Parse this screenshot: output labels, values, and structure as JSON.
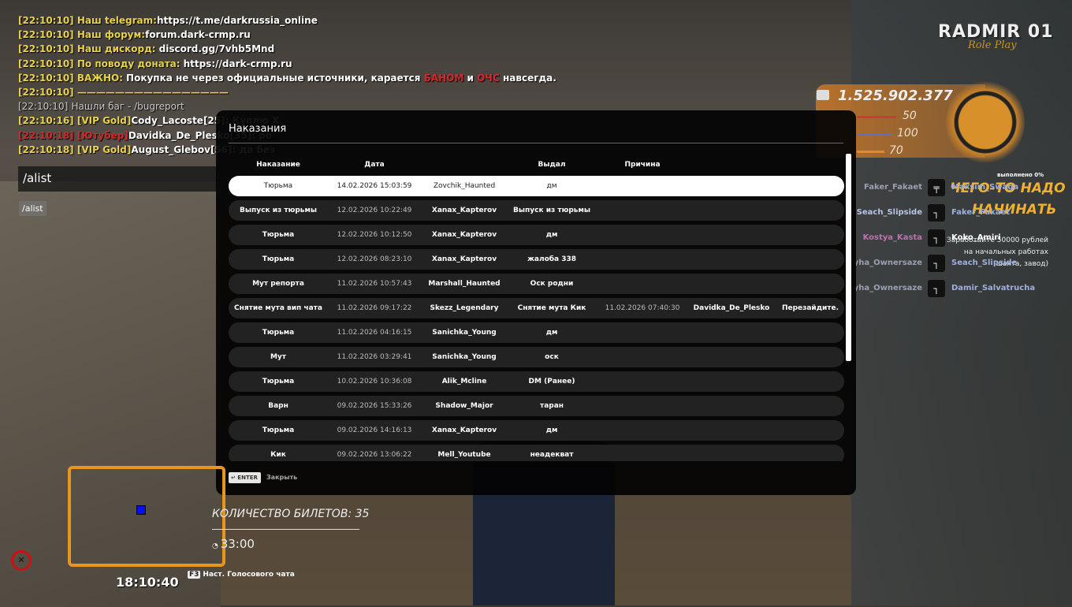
{
  "chat": {
    "lines": [
      {
        "time": "[22:10:10]",
        "label": "Наш telegram:",
        "text": "https://t.me/darkrussia_online"
      },
      {
        "time": "[22:10:10]",
        "label": "Наш форум:",
        "text": "forum.dark-crmp.ru"
      },
      {
        "time": "[22:10:10]",
        "label": "Наш дискорд:",
        "text": "discord.gg/7vhb5Mnd"
      },
      {
        "time": "[22:10:10]",
        "label": "По поводу доната:",
        "text": "https://dark-crmp.ru"
      },
      {
        "time": "[22:10:10]",
        "label": "ВАЖНО:",
        "text": "Покупка не через официальные источники, карается",
        "red1": "БАНОМ",
        "and": "и",
        "red2": "ОЧС",
        "tail": "навсегда."
      },
      {
        "time": "[22:10:10]",
        "label": "————————————————"
      },
      {
        "time": "[22:10:10]",
        "text": "Нашли баг - /bugreport"
      },
      {
        "time": "[22:10:16]",
        "label": "[VIP Gold]",
        "text": "Cody_Lacoste[25]: Куплю Х"
      },
      {
        "time": "[22:10:18]",
        "label": "[Ютубер]",
        "text": "Davidka_De_Plesko[35]: ро"
      },
      {
        "time": "[22:10:18]",
        "label": "[VIP Gold]",
        "text": "August_Glebov[56]: да без"
      }
    ],
    "input_value": "/alist",
    "suggestion": "/alist"
  },
  "modal": {
    "title": "Наказания",
    "headers": [
      "Наказание",
      "Дата",
      "Выдал",
      "Причина"
    ],
    "rows": [
      [
        "Тюрьма",
        "14.02.2026 15:03:59",
        "Zovchik_Haunted",
        "дм",
        "",
        "",
        ""
      ],
      [
        "Выпуск из тюрьмы",
        "12.02.2026 10:22:49",
        "Xanax_Kapterov",
        "Выпуск из тюрьмы",
        "",
        "",
        ""
      ],
      [
        "Тюрьма",
        "12.02.2026 10:12:50",
        "Xanax_Kapterov",
        "дм",
        "",
        "",
        ""
      ],
      [
        "Тюрьма",
        "12.02.2026 08:23:10",
        "Xanax_Kapterov",
        "жалоба 338",
        "",
        "",
        ""
      ],
      [
        "Мут репорта",
        "11.02.2026 10:57:43",
        "Marshall_Haunted",
        "Оск родни",
        "",
        "",
        ""
      ],
      [
        "Снятие мута вип чата",
        "11.02.2026 09:17:22",
        "Skezz_Legendary",
        "Снятие мута Кик",
        "11.02.2026 07:40:30",
        "Davidka_De_Plesko",
        "Перезайдите."
      ],
      [
        "Тюрьма",
        "11.02.2026 04:16:15",
        "Sanichka_Young",
        "дм",
        "",
        "",
        ""
      ],
      [
        "Мут",
        "11.02.2026 03:29:41",
        "Sanichka_Young",
        "оск",
        "",
        "",
        ""
      ],
      [
        "Тюрьма",
        "10.02.2026 10:36:08",
        "Alik_Mcline",
        "DM (Ранее)",
        "",
        "",
        ""
      ],
      [
        "Варн",
        "09.02.2026 15:33:26",
        "Shadow_Major",
        "таран",
        "",
        "",
        ""
      ],
      [
        "Тюрьма",
        "09.02.2026 14:16:13",
        "Xanax_Kapterov",
        "дм",
        "",
        "",
        ""
      ],
      [
        "Кик",
        "09.02.2026 13:06:22",
        "Mell_Youtube",
        "неадекват",
        "",
        "",
        ""
      ]
    ],
    "enter_key": "↵ ENTER",
    "close_label": "Закрыть"
  },
  "hud": {
    "logo": "RADMIR 01",
    "logo_sub": "Role Play",
    "money": "1.525.902.377",
    "health": "50",
    "armor": "100",
    "hunger": "70",
    "quest_progress": "выполнено 0%",
    "quest_title_1": "ЧЕГО-ТО НАДО",
    "quest_title_2": "НАЧИНАТЬ",
    "quest_desc": "Заработайте 50000 рублей на начальных работах (шахта, завод)",
    "killfeed": [
      {
        "killer": "Faker_Fakaet",
        "weapon": "rifle-icon",
        "victim": "Maksim_Swaga"
      },
      {
        "killer": "Seach_Slipside",
        "weapon": "pistol-icon",
        "victim": "Faker_Fakaet"
      },
      {
        "killer": "Kostya_Kasta",
        "weapon": "pistol-icon",
        "victim": "Koko_Amiri"
      },
      {
        "killer": "Klassyha_Ownersaze",
        "weapon": "pistol-icon",
        "victim": "Seach_Slipside"
      },
      {
        "killer": "Klassyha_Ownersaze",
        "weapon": "pistol-icon",
        "victim": "Damir_Salvatrucha"
      }
    ],
    "tickets": "КОЛИЧЕСТВО БИЛЕТОВ: 35",
    "timer": "33:00",
    "clock": "18:10:40",
    "voice_key": "F3",
    "voice_label": "Наст. Голосового чата"
  }
}
